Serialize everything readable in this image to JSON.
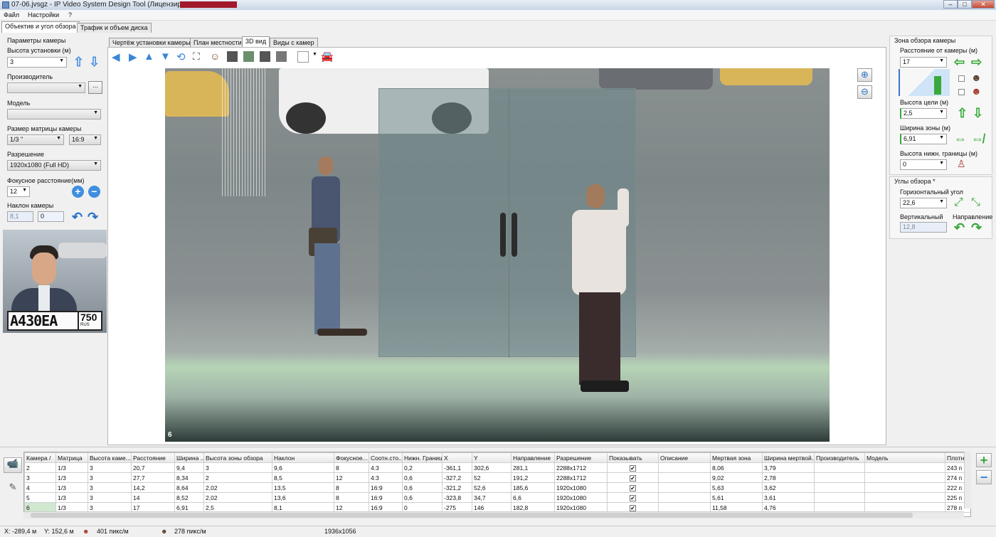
{
  "window": {
    "title": "07-06.jvsgz - IP Video System Design Tool (Лицензировано",
    "min": "–",
    "max": "□",
    "close": "✕"
  },
  "menu": [
    "Файл",
    "Настройки",
    "?"
  ],
  "main_tabs": [
    "Объектив и угол обзора",
    "Трафик и объем диска"
  ],
  "left": {
    "section_title": "Параметры камеры",
    "height_label": "Высота установки (м)",
    "height_value": "3",
    "manufacturer_label": "Производитель",
    "manufacturer_value": "",
    "browse_button": "...",
    "model_label": "Модель",
    "model_value": "",
    "sensor_label": "Размер матрицы камеры",
    "sensor_value": "1/3 \"",
    "aspect_value": "16:9",
    "resolution_label": "Разрешение",
    "resolution_value": "1920x1080 (Full HD)",
    "focal_label": "Фокусное расстояние(мм)",
    "focal_value": "12",
    "tilt_label": "Наклон камеры",
    "tilt_value": "8,1",
    "pan_value": "0",
    "plate_text": "А430ЕА",
    "plate_region": "750",
    "plate_country": "RUS"
  },
  "view_tabs": [
    "Чертёж установки камеры",
    "План местности",
    "3D вид",
    "Виды с камер"
  ],
  "view_label": "6",
  "right": {
    "zone_title": "Зона обзора камеры",
    "distance_label": "Расстояние от камеры (м)",
    "distance_value": "17",
    "target_height_label": "Высота цели (м)",
    "target_height_value": "2,5",
    "zone_width_label": "Ширина зоны (м)",
    "zone_width_value": "6,91",
    "lower_bound_label": "Высота нижн. границы (м)",
    "lower_bound_value": "0",
    "angles_title": "Углы обзора *",
    "horizontal_label": "Горизонтальный угол",
    "horizontal_value": "22,6",
    "vertical_label": "Вертикальный",
    "vertical_value": "12,8",
    "direction_label": "Направление"
  },
  "table": {
    "columns": [
      "Камера /",
      "Матрица",
      "Высота каме...",
      "Расстояние",
      "Ширина ...",
      "Высота зоны обзора",
      "Наклон",
      "Фокусное...",
      "Соотн.сто...",
      "Нижн. Граница",
      "X",
      "Y",
      "Направление",
      "Разрешение",
      "Показывать",
      "Описание",
      "Мертвая зона",
      "Ширина мертвой...",
      "Производитель",
      "Модель",
      "Плотн"
    ],
    "rows": [
      [
        "2",
        "1/3",
        "3",
        "20,7",
        "9,4",
        "3",
        "9,6",
        "8",
        "4:3",
        "0,2",
        "-361,1",
        "302,6",
        "281,1",
        "2288x1712",
        "✔",
        "",
        "8,06",
        "3,79",
        "",
        "",
        "243 п"
      ],
      [
        "3",
        "1/3",
        "3",
        "27,7",
        "8,34",
        "2",
        "8,5",
        "12",
        "4:3",
        "0,6",
        "-327,2",
        "52",
        "191,2",
        "2288x1712",
        "✔",
        "",
        "9,02",
        "2,78",
        "",
        "",
        "274 п"
      ],
      [
        "4",
        "1/3",
        "3",
        "14,2",
        "8,64",
        "2,02",
        "13,5",
        "8",
        "16:9",
        "0,6",
        "-321,2",
        "52,6",
        "185,6",
        "1920x1080",
        "✔",
        "",
        "5,63",
        "3,62",
        "",
        "",
        "222 п"
      ],
      [
        "5",
        "1/3",
        "3",
        "14",
        "8,52",
        "2,02",
        "13,6",
        "8",
        "16:9",
        "0,6",
        "-323,8",
        "34,7",
        "6,6",
        "1920x1080",
        "✔",
        "",
        "5,61",
        "3,61",
        "",
        "",
        "225 п"
      ],
      [
        "6",
        "1/3",
        "3",
        "17",
        "6,91",
        "2,5",
        "8,1",
        "12",
        "16:9",
        "0",
        "-275",
        "146",
        "182,8",
        "1920x1080",
        "✔",
        "",
        "11,58",
        "4,76",
        "",
        "",
        "278 п"
      ]
    ],
    "selected_row": 4
  },
  "status": {
    "x": "X: -289,4 м",
    "y": "Y: 152,6 м",
    "density1": "401 пикс/м",
    "density2": "278 пикс/м",
    "screen": "1936x1056"
  },
  "colors": {
    "accent_green": "#3aa83a",
    "accent_blue": "#4a90e2",
    "selection": "#cfe8cf",
    "title_redaction": "#a2192b"
  }
}
